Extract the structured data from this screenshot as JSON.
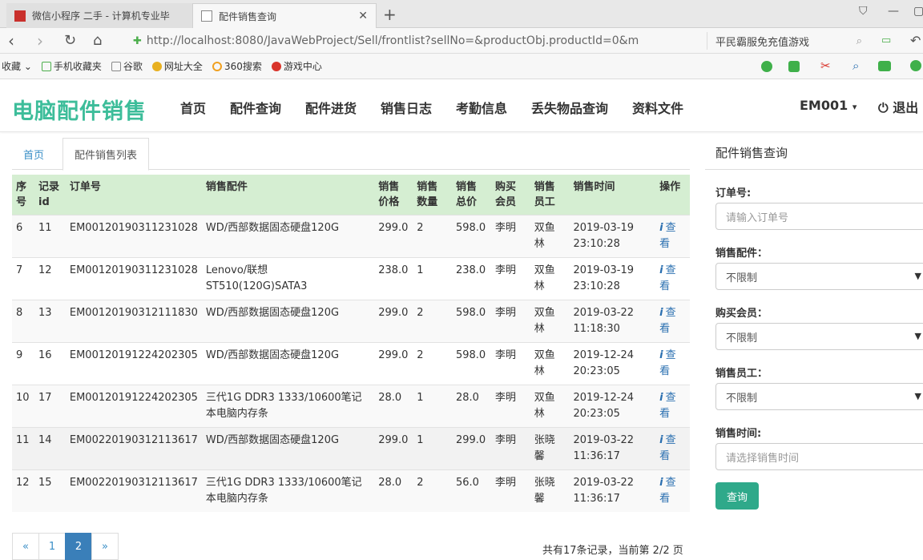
{
  "browser": {
    "tabs": [
      {
        "title": "微信小程序 二手 - 计算机专业毕"
      },
      {
        "title": "配件销售查询"
      }
    ],
    "url": "http://localhost:8080/JavaWebProject/Sell/frontlist?sellNo=&productObj.productId=0&m",
    "search_text": "平民霸服免充值游戏",
    "bookmarks": [
      "收藏",
      "手机收藏夹",
      "谷歌",
      "网址大全",
      "360搜索",
      "游戏中心"
    ]
  },
  "app": {
    "brand": "电脑配件销售",
    "nav": [
      "首页",
      "配件查询",
      "配件进货",
      "销售日志",
      "考勤信息",
      "丢失物品查询",
      "资料文件"
    ],
    "user": "EM001",
    "logout": "退出"
  },
  "content_tabs": [
    "首页",
    "配件销售列表"
  ],
  "table": {
    "headers": [
      "序号",
      "记录id",
      "订单号",
      "销售配件",
      "销售价格",
      "销售数量",
      "销售总价",
      "购买会员",
      "销售员工",
      "销售时间",
      "操作"
    ],
    "rows": [
      [
        "6",
        "11",
        "EM00120190311231028",
        "WD/西部数据固态硬盘120G",
        "299.0",
        "2",
        "598.0",
        "李明",
        "双鱼林",
        "2019-03-19 23:10:28",
        "查看"
      ],
      [
        "7",
        "12",
        "EM00120190311231028",
        "Lenovo/联想 ST510(120G)SATA3",
        "238.0",
        "1",
        "238.0",
        "李明",
        "双鱼林",
        "2019-03-19 23:10:28",
        "查看"
      ],
      [
        "8",
        "13",
        "EM00120190312111830",
        "WD/西部数据固态硬盘120G",
        "299.0",
        "2",
        "598.0",
        "李明",
        "双鱼林",
        "2019-03-22 11:18:30",
        "查看"
      ],
      [
        "9",
        "16",
        "EM00120191224202305",
        "WD/西部数据固态硬盘120G",
        "299.0",
        "2",
        "598.0",
        "李明",
        "双鱼林",
        "2019-12-24 20:23:05",
        "查看"
      ],
      [
        "10",
        "17",
        "EM00120191224202305",
        "三代1G DDR3 1333/10600笔记本电脑内存条",
        "28.0",
        "1",
        "28.0",
        "李明",
        "双鱼林",
        "2019-12-24 20:23:05",
        "查看"
      ],
      [
        "11",
        "14",
        "EM00220190312113617",
        "WD/西部数据固态硬盘120G",
        "299.0",
        "1",
        "299.0",
        "李明",
        "张晓馨",
        "2019-03-22 11:36:17",
        "查看"
      ],
      [
        "12",
        "15",
        "EM00220190312113617",
        "三代1G DDR3 1333/10600笔记本电脑内存条",
        "28.0",
        "2",
        "56.0",
        "李明",
        "张晓馨",
        "2019-03-22 11:36:17",
        "查看"
      ]
    ]
  },
  "pager": {
    "prev": "«",
    "pages": [
      "1",
      "2"
    ],
    "next": "»",
    "current": "2",
    "info": "共有17条记录，当前第 2/2 页"
  },
  "filter": {
    "title": "配件销售查询",
    "order_label": "订单号:",
    "order_placeholder": "请输入订单号",
    "part_label": "销售配件：",
    "part_value": "不限制",
    "member_label": "购买会员：",
    "member_value": "不限制",
    "staff_label": "销售员工：",
    "staff_value": "不限制",
    "time_label": "销售时间:",
    "time_placeholder": "请选择销售时间",
    "query_button": "查询"
  }
}
